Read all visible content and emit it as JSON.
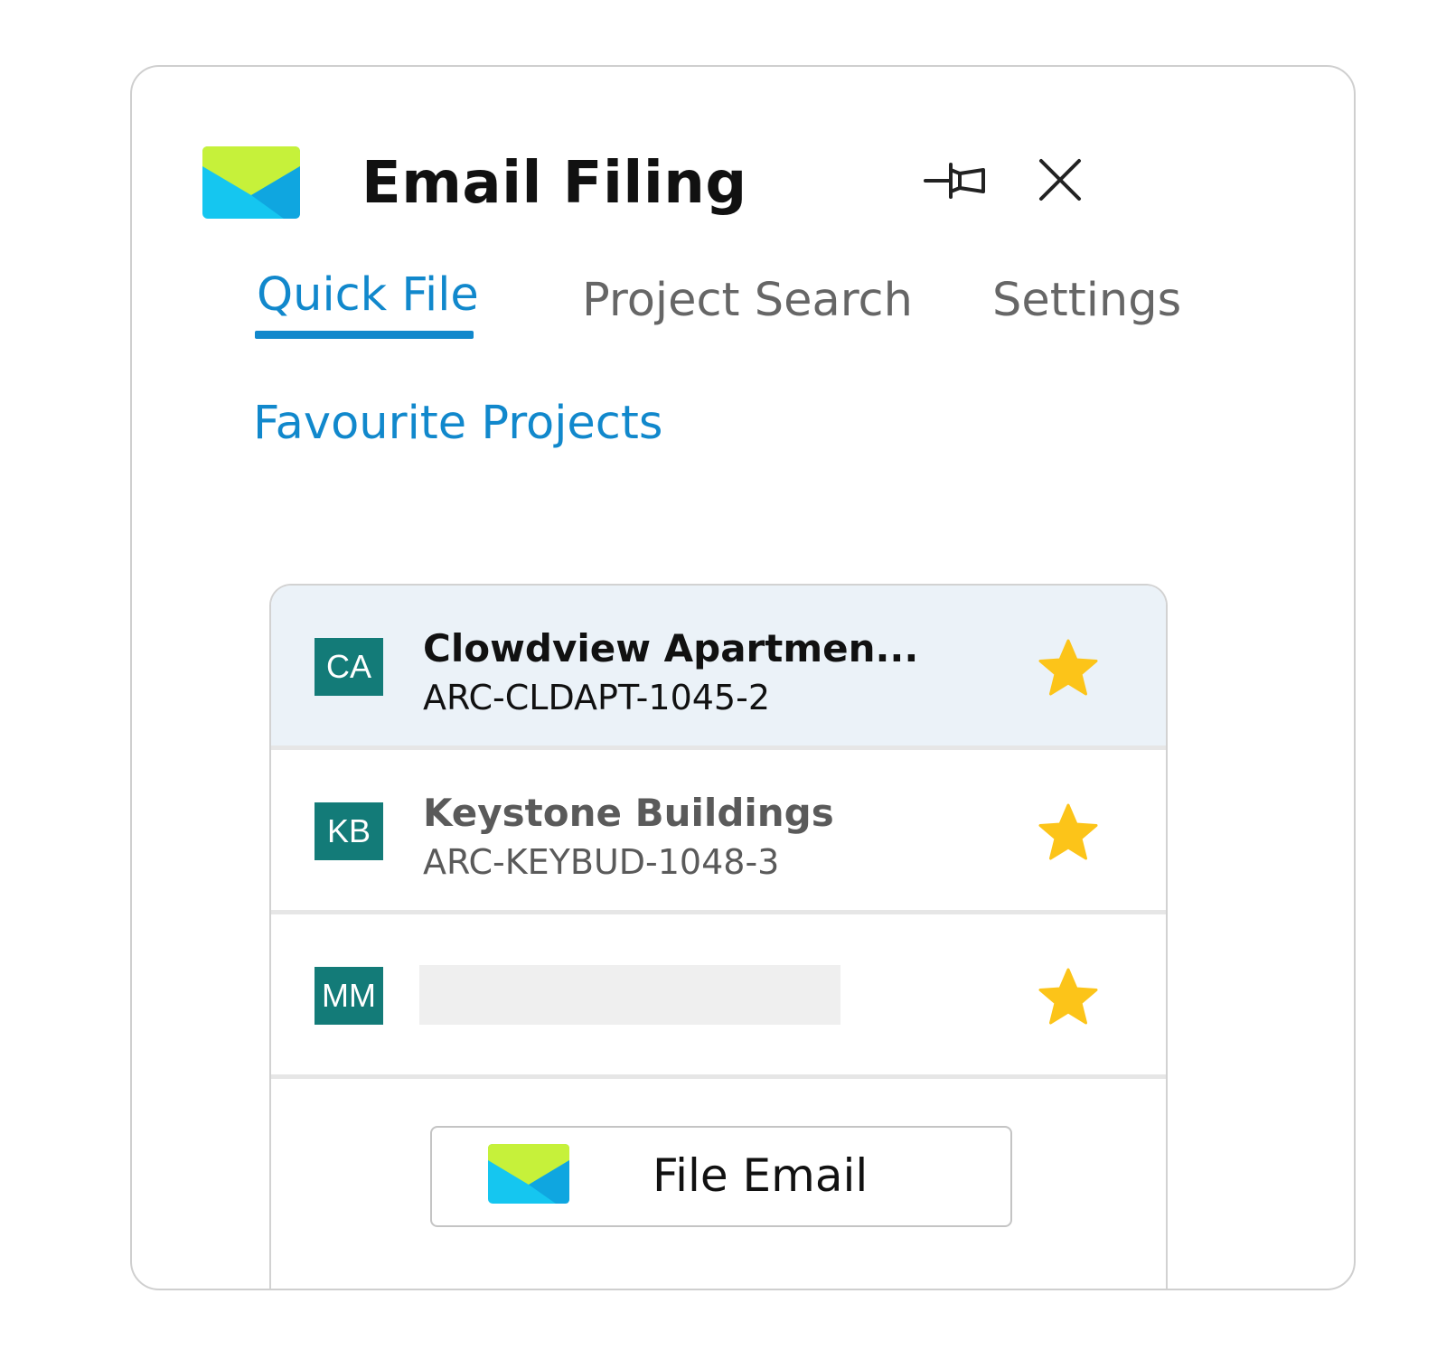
{
  "header": {
    "title": "Email Filing",
    "logo_icon": "envelope-icon",
    "pin_icon": "pin-icon",
    "close_icon": "close-icon"
  },
  "tabs": [
    {
      "label": "Quick File",
      "active": true
    },
    {
      "label": "Project Search",
      "active": false
    },
    {
      "label": "Settings",
      "active": false
    }
  ],
  "section_title": "Favourite Projects",
  "projects": [
    {
      "initials": "CA",
      "name": "Clowdview Apartmen...",
      "code": "ARC-CLDAPT-1045-2",
      "favourite": true,
      "selected": true
    },
    {
      "initials": "KB",
      "name": "Keystone Buildings",
      "code": "ARC-KEYBUD-1048-3",
      "favourite": true,
      "selected": false
    },
    {
      "initials": "MM",
      "name": "",
      "code": "",
      "favourite": true,
      "selected": false
    }
  ],
  "file_button": {
    "label": "File Email",
    "icon": "envelope-icon"
  },
  "colors": {
    "accent": "#1188cc",
    "avatar": "#137b78",
    "star": "#fcc419",
    "selected_row": "#ebf2f8",
    "envelope_top": "#c6f13a",
    "envelope_body": "#15c6f0"
  }
}
